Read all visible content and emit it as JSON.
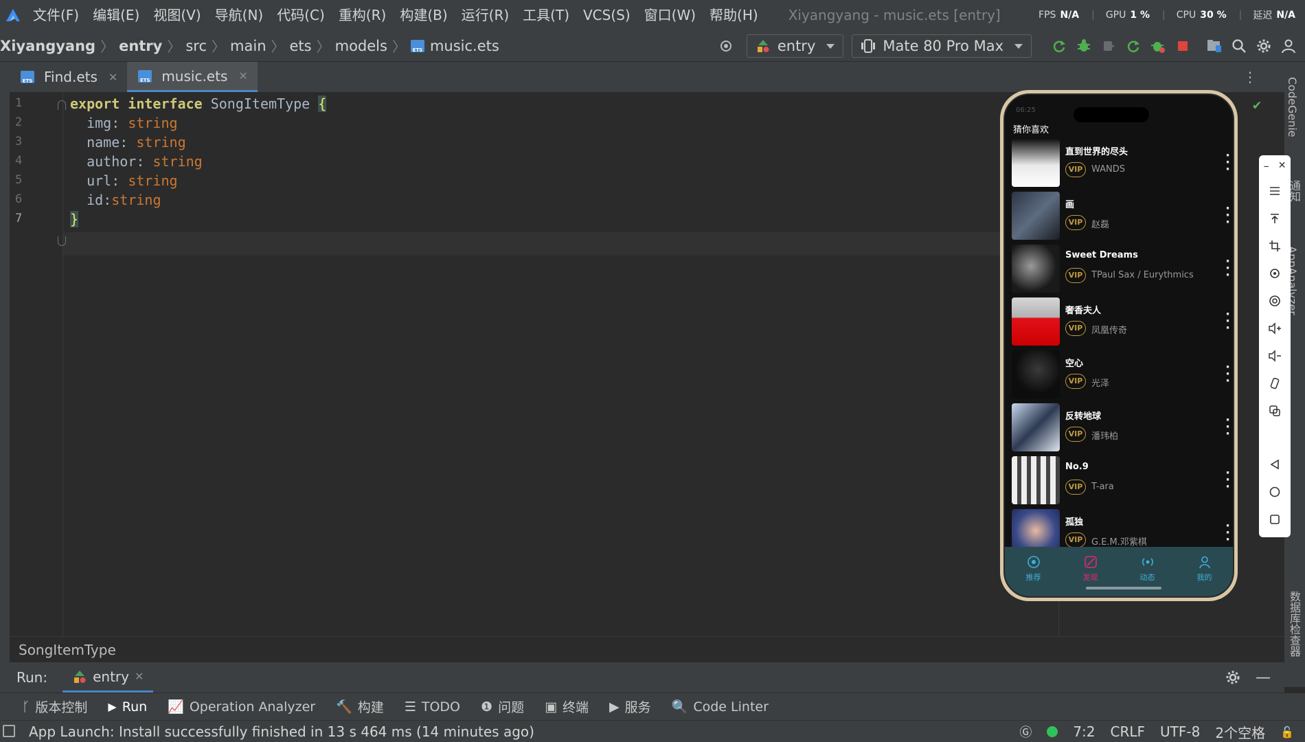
{
  "menubar": {
    "items": [
      "文件(F)",
      "编辑(E)",
      "视图(V)",
      "导航(N)",
      "代码(C)",
      "重构(R)",
      "构建(B)",
      "运行(R)",
      "工具(T)",
      "VCS(S)",
      "窗口(W)",
      "帮助(H)"
    ],
    "window_title": "Xiyangyang - music.ets [entry]",
    "perf": {
      "fps_label": "FPS",
      "fps_value": "N/A",
      "gpu_label": "GPU",
      "gpu_value": "1 %",
      "cpu_label": "CPU",
      "cpu_value": "30 %",
      "latency_label": "延迟",
      "latency_value": "N/A"
    }
  },
  "breadcrumbs": [
    "Xiyangyang",
    "entry",
    "src",
    "main",
    "ets",
    "models",
    "music.ets"
  ],
  "run_config": {
    "module": "entry",
    "device": "Mate 80 Pro Max"
  },
  "tabs": [
    {
      "label": "Find.ets",
      "active": false
    },
    {
      "label": "music.ets",
      "active": true
    }
  ],
  "editor": {
    "line_numbers": [
      "1",
      "2",
      "3",
      "4",
      "5",
      "6",
      "7"
    ],
    "lines": [
      {
        "kw1": "export",
        "kw2": "interface",
        "name": "SongItemType",
        "brace": "{"
      },
      {
        "prop": "img",
        "type": "string"
      },
      {
        "prop": "name",
        "type": "string"
      },
      {
        "prop": "author",
        "type": "string"
      },
      {
        "prop": "url",
        "type": "string"
      },
      {
        "prop": "id",
        "type": "string"
      },
      {
        "brace": "}"
      }
    ]
  },
  "structure_path": "SongItemType",
  "phone": {
    "status_time": "06:25",
    "section_title": "猜你喜欢",
    "vip_label": "VIP",
    "songs": [
      {
        "name": "直到世界的尽头",
        "author": "WANDS"
      },
      {
        "name": "画",
        "author": "赵磊"
      },
      {
        "name": "Sweet Dreams",
        "author": "TPaul Sax / Eurythmics"
      },
      {
        "name": "奢香夫人",
        "author": "凤凰传奇"
      },
      {
        "name": "空心",
        "author": "光泽"
      },
      {
        "name": "反转地球",
        "author": "潘玮柏"
      },
      {
        "name": "No.9",
        "author": "T-ara"
      },
      {
        "name": "孤独",
        "author": "G.E.M.邓紫棋"
      }
    ],
    "nav": [
      "推荐",
      "发现",
      "动态",
      "我的"
    ]
  },
  "run_bar": {
    "label": "Run:",
    "tab": "entry"
  },
  "tool_windows": [
    "版本控制",
    "Run",
    "Operation Analyzer",
    "构建",
    "TODO",
    "问题",
    "终端",
    "服务",
    "Code Linter"
  ],
  "right_strip": [
    "CodeGenie",
    "通知",
    "AppAnalyzer",
    "数据库检查器"
  ],
  "status": {
    "message": "App Launch: Install successfully finished in 13 s 464 ms (14 minutes ago)",
    "caret": "7:2",
    "line_sep": "CRLF",
    "encoding": "UTF-8",
    "indent": "2个空格"
  },
  "colors": {
    "accent": "#4a88c7",
    "vip_gold": "#c19a3d",
    "nav_active": "#e6286c",
    "nav_inactive": "#3eb0d6"
  }
}
